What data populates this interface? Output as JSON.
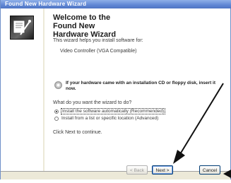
{
  "window": {
    "title": "Found New Hardware Wizard"
  },
  "heading": "Welcome to the Found New Hardware Wizard",
  "intro_text": "This wizard helps you install software for:",
  "device_name": "Video Controller (VGA Compatible)",
  "cd_prompt": "If your hardware came with an installation CD or floppy disk, insert it now.",
  "question": "What do you want the wizard to do?",
  "options": [
    {
      "label": "Install the software automatically (Recommended)",
      "selected": true
    },
    {
      "label": "Install from a list or specific location (Advanced)",
      "selected": false
    }
  ],
  "continue_text": "Click Next to continue.",
  "buttons": {
    "back": "< Back",
    "next": "Next >",
    "cancel": "Cancel"
  },
  "icons": {
    "wizard": "hardware-wizard-icon",
    "cd": "cd-icon"
  }
}
